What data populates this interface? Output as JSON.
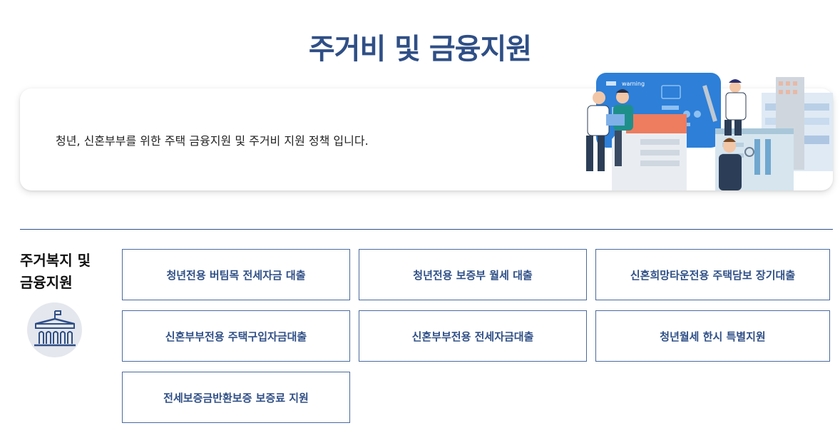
{
  "page": {
    "title": "주거비 및 금융지원"
  },
  "intro": {
    "description": "청년, 신혼부부를 위한 주택 금융지원 및 주거비 지원 정책 입니다.",
    "illustration_sign_text": "warning"
  },
  "section": {
    "title_line1": "주거복지 및",
    "title_line2": "금융지원",
    "icon": "government-building-icon"
  },
  "links": [
    {
      "label": "청년전용 버팀목 전세자금 대출"
    },
    {
      "label": "청년전용 보증부 월세 대출"
    },
    {
      "label": "신혼희망타운전용 주택담보 장기대출"
    },
    {
      "label": "신혼부부전용 주택구입자금대출"
    },
    {
      "label": "신혼부부전용 전세자금대출"
    },
    {
      "label": "청년월세 한시 특별지원"
    },
    {
      "label": "전세보증금반환보증 보증료 지원"
    }
  ],
  "colors": {
    "accent": "#2f4f86",
    "border": "#4a6a9c",
    "icon_bg": "#e4e7ed"
  }
}
